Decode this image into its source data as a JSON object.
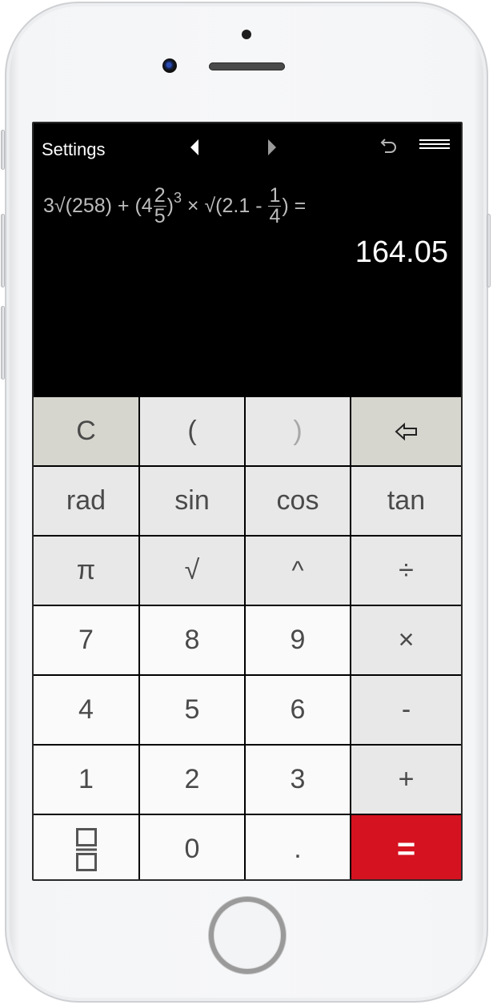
{
  "topbar": {
    "settings_label": "Settings",
    "icons": [
      "back-arrow-icon",
      "forward-arrow-icon",
      "undo-icon",
      "menu-icon"
    ]
  },
  "display": {
    "expression": {
      "p1": "3√(258) + (4",
      "frac1_num": "2",
      "frac1_den": "5",
      "p2": ")",
      "exp": "3",
      "p3": " × √(2.1 - ",
      "frac2_num": "1",
      "frac2_den": "4",
      "p4": ") ="
    },
    "result": "164.05"
  },
  "keys": {
    "clear": "C",
    "open_paren": "(",
    "close_paren": ")",
    "backspace_icon": "backspace-arrow-icon",
    "rad": "rad",
    "sin": "sin",
    "cos": "cos",
    "tan": "tan",
    "pi": "π",
    "sqrt": "√",
    "power": "^",
    "divide": "÷",
    "seven": "7",
    "eight": "8",
    "nine": "9",
    "multiply": "×",
    "four": "4",
    "five": "5",
    "six": "6",
    "minus": "-",
    "one": "1",
    "two": "2",
    "three": "3",
    "plus": "+",
    "fraction_icon": "fraction-icon",
    "zero": "0",
    "decimal": ".",
    "equals": "="
  },
  "colors": {
    "equals_key": "#d51220",
    "control_key": "#d6d5ce",
    "function_key": "#e8e8e8",
    "number_key": "#fafafa",
    "display_bg": "#000000"
  }
}
